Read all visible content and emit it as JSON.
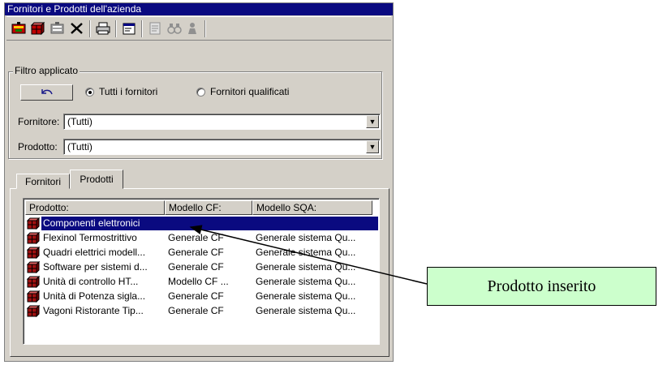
{
  "window": {
    "title": "Fornitori e Prodotti dell'azienda"
  },
  "toolbar": {
    "buttons": [
      {
        "name": "new-supplier-icon",
        "color": "#c00000"
      },
      {
        "name": "new-product-icon",
        "color": "#c00000"
      },
      {
        "name": "edit-icon",
        "color": "#808080"
      },
      {
        "name": "delete-icon",
        "color": "#000000"
      },
      {
        "name": "print-icon",
        "color": "#000000"
      },
      {
        "name": "properties-icon",
        "color": "#000000"
      },
      {
        "name": "document-icon",
        "color": "#808080"
      },
      {
        "name": "binoculars-icon",
        "color": "#808080"
      },
      {
        "name": "person-icon",
        "color": "#808080"
      }
    ]
  },
  "filter": {
    "group_label": "Filtro applicato",
    "undo_icon": "undo-arrow-icon",
    "radio_all": "Tutti i fornitori",
    "radio_qualified": "Fornitori qualificati",
    "selected": "Tutti i fornitori",
    "supplier_label": "Fornitore:",
    "supplier_value": "(Tutti)",
    "product_label": "Prodotto:",
    "product_value": "(Tutti)"
  },
  "tabs": {
    "suppliers": "Fornitori",
    "products": "Prodotti",
    "active": "Prodotti"
  },
  "list": {
    "columns": [
      "Prodotto:",
      "Modello CF:",
      "Modello SQA:"
    ],
    "rows": [
      {
        "product": "Componenti elettronici",
        "cf": "",
        "sqa": "",
        "selected": true
      },
      {
        "product": "Flexinol Termostrittivo",
        "cf": "Generale CF",
        "sqa": "Generale sistema Qu..."
      },
      {
        "product": "Quadri elettrici modell...",
        "cf": "Generale CF",
        "sqa": "Generale sistema Qu..."
      },
      {
        "product": "Software per sistemi d...",
        "cf": "Generale CF",
        "sqa": "Generale sistema Qu..."
      },
      {
        "product": "Unità di controllo HT...",
        "cf": "Modello CF ...",
        "sqa": "Generale sistema Qu..."
      },
      {
        "product": "Unità di Potenza sigla...",
        "cf": "Generale CF",
        "sqa": "Generale sistema Qu..."
      },
      {
        "product": "Vagoni Ristorante Tip...",
        "cf": "Generale CF",
        "sqa": "Generale sistema Qu..."
      }
    ]
  },
  "callout": {
    "text": "Prodotto inserito",
    "color": "#ccffcc"
  },
  "colors": {
    "selection": "#0a0a80",
    "face": "#d4d0c8",
    "icon_red": "#a01010"
  }
}
